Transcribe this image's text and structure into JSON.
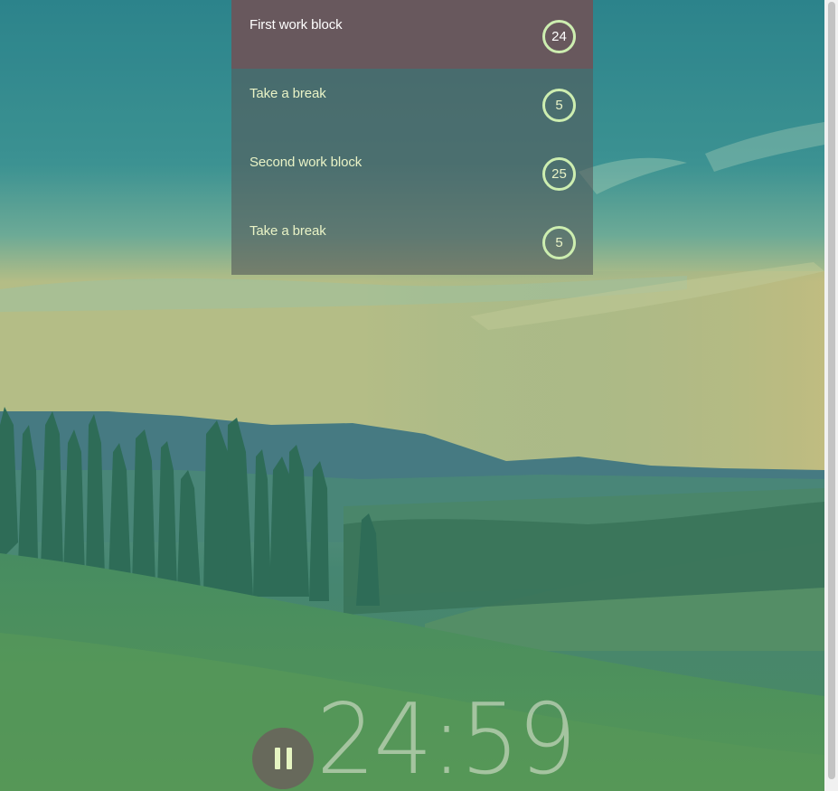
{
  "tasks": [
    {
      "label": "First work block",
      "minutes": "24",
      "active": true
    },
    {
      "label": "Take a break",
      "minutes": "5",
      "active": false
    },
    {
      "label": "Second work block",
      "minutes": "25",
      "active": false
    },
    {
      "label": "Take a break",
      "minutes": "5",
      "active": false
    }
  ],
  "timer": {
    "display": "24:59"
  },
  "controls": {
    "pause_icon": "pause-icon"
  },
  "colors": {
    "accent": "#cdeeb0",
    "active_row": "#6e555a",
    "list_bg": "#555a5a"
  }
}
